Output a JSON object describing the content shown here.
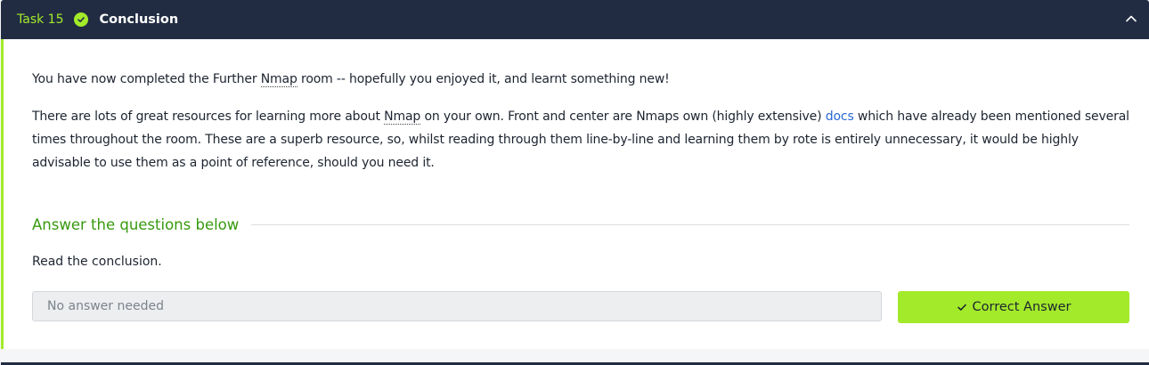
{
  "task": {
    "number_label": "Task 15",
    "title": "Conclusion",
    "status": "completed",
    "accent_color": "#a3ea2a",
    "header_color": "#212c42"
  },
  "content": {
    "para1": {
      "before_abbr": "You have now completed the Further ",
      "abbr": "Nmap",
      "after_abbr": " room -- hopefully you enjoyed it, and learnt something new!"
    },
    "para2": {
      "before_abbr": "There are lots of great resources for learning more about ",
      "abbr": "Nmap",
      "middle": " on your own. Front and center are Nmaps own (highly extensive) ",
      "link_text": "docs",
      "after_link": " which have already been mentioned several times throughout the room. These are a superb resource, so, whilst reading through them line-by-line and learning them by rote is entirely unnecessary, it would be highly advisable to use them as a point of reference, should you need it."
    }
  },
  "questions": {
    "heading": "Answer the questions below",
    "items": [
      {
        "text": "Read the conclusion.",
        "answer_placeholder": "No answer needed",
        "button_label": "Correct Answer"
      }
    ]
  },
  "icons": {
    "status": "check-circle-icon",
    "collapse": "chevron-up-icon",
    "button": "check-icon"
  }
}
